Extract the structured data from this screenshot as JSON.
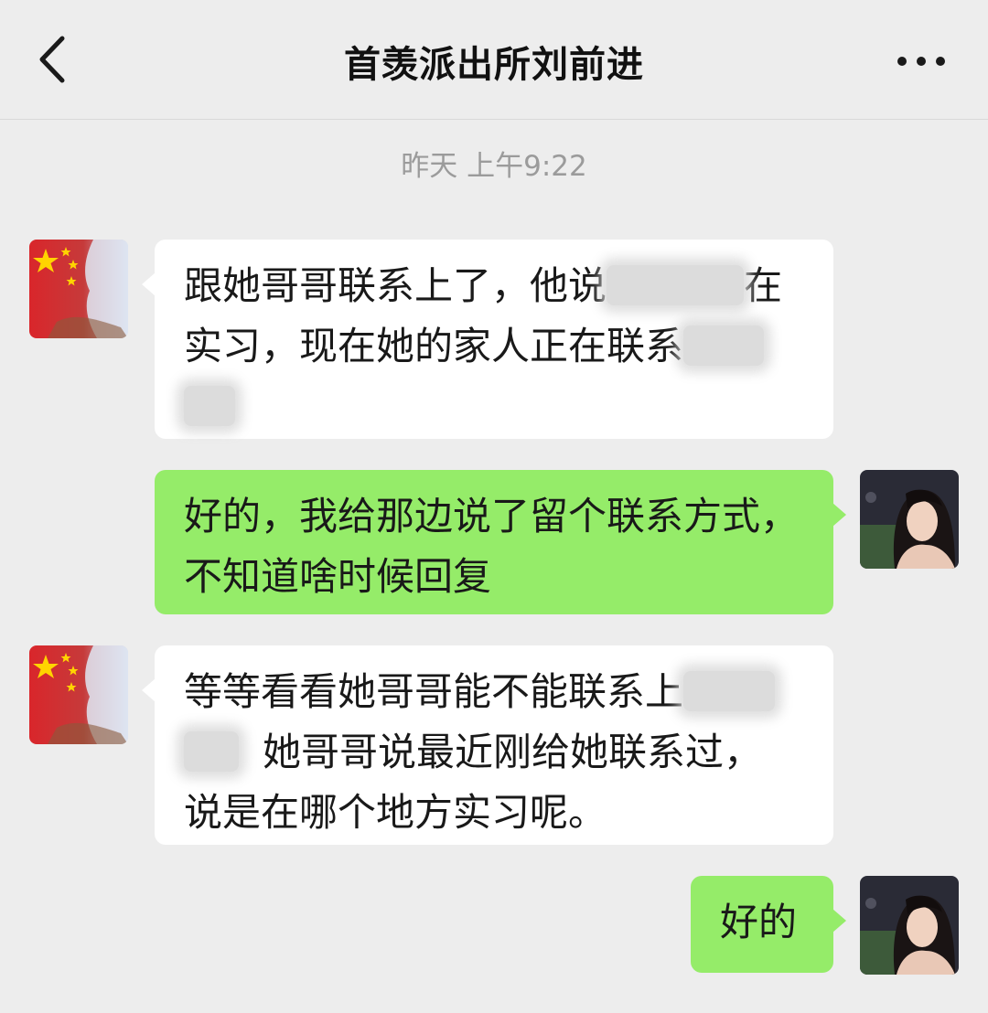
{
  "header": {
    "title": "首羡派出所刘前进",
    "back_icon": "chevron-left-icon",
    "more_icon": "more-dots-icon"
  },
  "timestamp": "昨天 上午9:22",
  "colors": {
    "background": "#ededed",
    "received_bubble": "#ffffff",
    "sent_bubble": "#95ec69"
  },
  "messages": [
    {
      "sender": "other",
      "lines": [
        [
          "跟她哥哥联系上了，他说",
          "",
          "在"
        ],
        [
          "实习，现在她的家人正在联系",
          ""
        ],
        [
          "",
          ""
        ]
      ]
    },
    {
      "sender": "me",
      "lines": [
        [
          "好的，我给那边说了留个联系方式，"
        ],
        [
          "不知道啥时候回复"
        ]
      ]
    },
    {
      "sender": "other",
      "lines": [
        [
          "等等看看她哥哥能不能联系上",
          ""
        ],
        [
          "",
          "她哥哥说最近刚给她联系过，"
        ],
        [
          "说是在哪个地方实习呢。"
        ]
      ]
    },
    {
      "sender": "me",
      "lines": [
        [
          "好的"
        ]
      ]
    }
  ]
}
